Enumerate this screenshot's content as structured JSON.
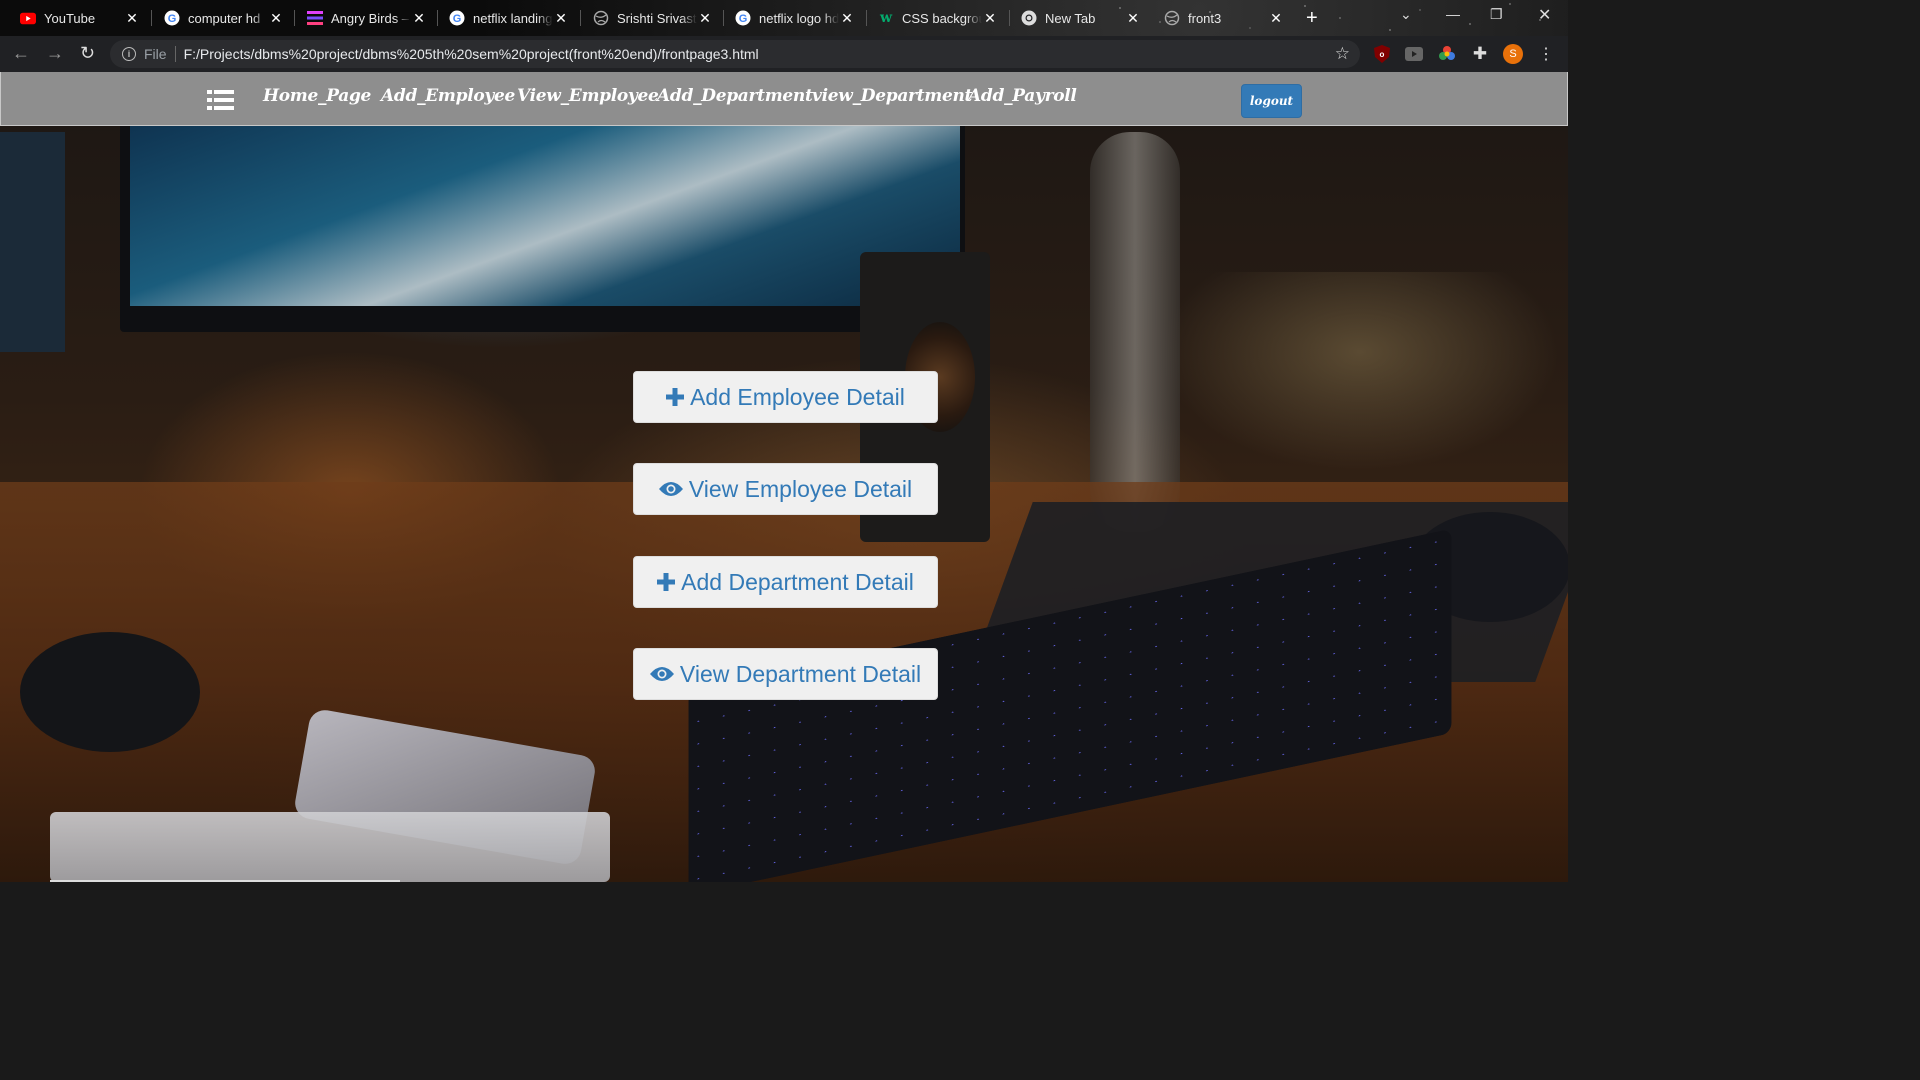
{
  "browser": {
    "tabs": [
      {
        "title": "YouTube",
        "icon": "youtube-icon"
      },
      {
        "title": "computer hd",
        "icon": "google-icon"
      },
      {
        "title": "Angry Birds –",
        "icon": "stripes-icon"
      },
      {
        "title": "netflix landing",
        "icon": "google-icon"
      },
      {
        "title": "Srishti Srivasta",
        "icon": "globe-icon"
      },
      {
        "title": "netflix logo hd",
        "icon": "google-icon"
      },
      {
        "title": "CSS backgrou",
        "icon": "w3schools-icon"
      },
      {
        "title": "New Tab",
        "icon": "chrome-icon"
      },
      {
        "title": "front3",
        "icon": "globe-icon"
      }
    ],
    "address_scheme": "File",
    "address_url": "F:/Projects/dbms%20project/dbms%205th%20sem%20project(front%20end)/frontpage3.html",
    "profile_initial": "S",
    "colors": {
      "profile": "#e8710a"
    }
  },
  "navbar": {
    "links": [
      {
        "label": "Home_Page"
      },
      {
        "label": "Add_Employee"
      },
      {
        "label": "View_Employee"
      },
      {
        "label": "Add_Department"
      },
      {
        "label": "view_Department"
      },
      {
        "label": "Add_Payroll"
      }
    ],
    "logout_label": "logout",
    "colors": {
      "background": "#8e8e8e",
      "logout": "#337ab7"
    }
  },
  "actions": [
    {
      "label": "Add Employee Detail",
      "icon": "plus-icon"
    },
    {
      "label": "View Employee Detail",
      "icon": "eye-icon"
    },
    {
      "label": "Add Department Detail",
      "icon": "plus-icon"
    },
    {
      "label": "View Department Detail",
      "icon": "eye-icon"
    }
  ],
  "colors": {
    "accent": "#337ab7",
    "button_bg": "#f0f0f0"
  }
}
